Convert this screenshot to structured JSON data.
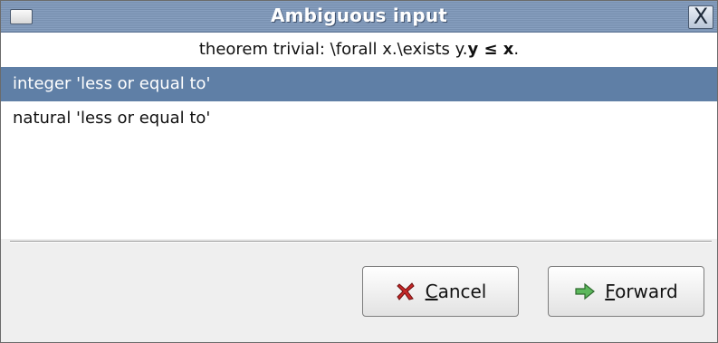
{
  "window": {
    "title": "Ambiguous input",
    "close_glyph": "X"
  },
  "question": {
    "prefix": "theorem trivial: \\forall x.\\exists y.",
    "bold_expr": "y ≤ x",
    "suffix": "."
  },
  "choices": [
    {
      "label": "integer 'less or equal to'",
      "selected": true
    },
    {
      "label": "natural 'less or equal to'",
      "selected": false
    }
  ],
  "buttons": {
    "cancel": {
      "mnemonic": "C",
      "rest": "ancel",
      "icon": "cancel-x-icon"
    },
    "forward": {
      "mnemonic": "F",
      "rest": "orward",
      "icon": "forward-arrow-icon"
    }
  },
  "colors": {
    "titlebar": "#7890b0",
    "selection": "#5f7fa6",
    "cancel_icon": "#c62828",
    "forward_icon": "#4caf50"
  }
}
